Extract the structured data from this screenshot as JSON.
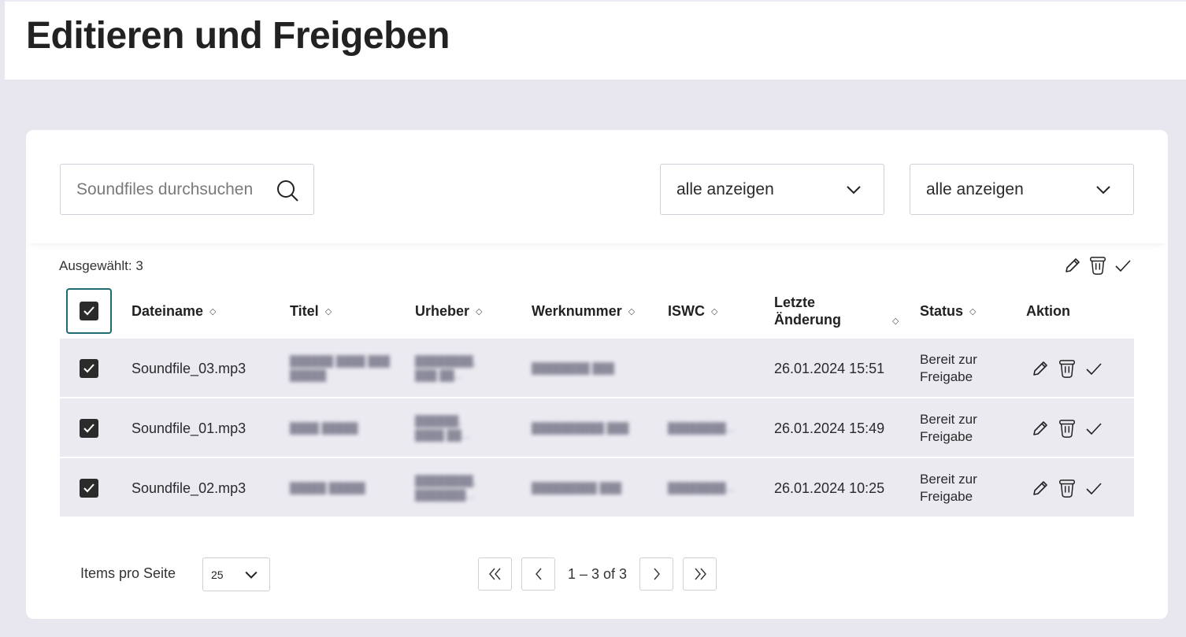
{
  "page": {
    "title": "Editieren und Freigeben"
  },
  "search": {
    "placeholder": "Soundfiles durchsuchen"
  },
  "filters": [
    {
      "value": "alle anzeigen"
    },
    {
      "value": "alle anzeigen"
    }
  ],
  "selection": {
    "label": "Ausgewählt: 3"
  },
  "table": {
    "columns": [
      "Dateiname",
      "Titel",
      "Urheber",
      "Werknummer",
      "ISWC",
      "Letzte Änderung",
      "Status",
      "Aktion"
    ],
    "rows": [
      {
        "filename": "Soundfile_03.mp3",
        "modified": "26.01.2024 15:51",
        "status_line1": "Bereit zur",
        "status_line2": "Freigabe",
        "checked": true
      },
      {
        "filename": "Soundfile_01.mp3",
        "modified": "26.01.2024 15:49",
        "status_line1": "Bereit zur",
        "status_line2": "Freigabe",
        "checked": true
      },
      {
        "filename": "Soundfile_02.mp3",
        "modified": "26.01.2024 10:25",
        "status_line1": "Bereit zur",
        "status_line2": "Freigabe",
        "checked": true
      }
    ]
  },
  "pagination": {
    "items_label": "Items pro Seite",
    "page_size": "25",
    "range": "1 – 3 of 3"
  },
  "icons": {
    "search": "search-icon",
    "chevron": "chevron-down-icon",
    "edit": "pencil-icon",
    "delete": "trash-icon",
    "approve": "check-icon",
    "first": "double-chevron-left-icon",
    "prev": "chevron-left-icon",
    "next": "chevron-right-icon",
    "last": "double-chevron-right-icon"
  },
  "colors": {
    "accent": "#1d6c70",
    "row_bg": "#ebeaf1",
    "page_bg": "#e8e7f0"
  }
}
